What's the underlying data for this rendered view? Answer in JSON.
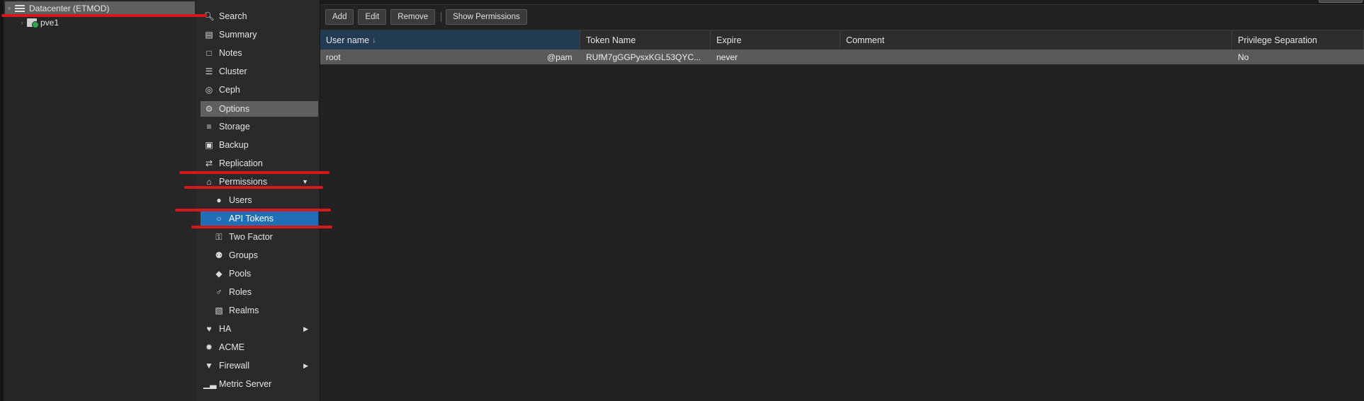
{
  "tree": {
    "datacenter": "Datacenter (ETMOD)",
    "node": "pve1"
  },
  "menu": {
    "items": [
      {
        "label": "Search",
        "icon": "search-icon"
      },
      {
        "label": "Summary",
        "icon": "book-icon"
      },
      {
        "label": "Notes",
        "icon": "notes-icon"
      },
      {
        "label": "Cluster",
        "icon": "server-icon"
      },
      {
        "label": "Ceph",
        "icon": "ceph-icon"
      },
      {
        "label": "Options",
        "icon": "gear-icon"
      },
      {
        "label": "Storage",
        "icon": "database-icon"
      },
      {
        "label": "Backup",
        "icon": "floppy-icon"
      },
      {
        "label": "Replication",
        "icon": "retweet-icon"
      },
      {
        "label": "Permissions",
        "icon": "unlock-icon"
      },
      {
        "label": "Users",
        "icon": "user-icon"
      },
      {
        "label": "API Tokens",
        "icon": "user-outline-icon"
      },
      {
        "label": "Two Factor",
        "icon": "key-icon"
      },
      {
        "label": "Groups",
        "icon": "users-icon"
      },
      {
        "label": "Pools",
        "icon": "tags-icon"
      },
      {
        "label": "Roles",
        "icon": "male-icon"
      },
      {
        "label": "Realms",
        "icon": "address-book-icon"
      },
      {
        "label": "HA",
        "icon": "heartbeat-icon"
      },
      {
        "label": "ACME",
        "icon": "certificate-icon"
      },
      {
        "label": "Firewall",
        "icon": "shield-icon"
      },
      {
        "label": "Metric Server",
        "icon": "bar-chart-icon"
      }
    ]
  },
  "toolbar": {
    "add": "Add",
    "edit": "Edit",
    "remove": "Remove",
    "show_permissions": "Show Permissions"
  },
  "grid": {
    "columns": [
      "User name",
      "Token Name",
      "Expire",
      "Comment",
      "Privilege Separation"
    ],
    "sort_indicator": "↓",
    "rows": [
      {
        "user": "root",
        "realm": "@pam",
        "token": "RUfM7gGGPysxKGL53QYC...",
        "expire": "never",
        "comment": "",
        "privsep": "No"
      }
    ]
  },
  "colors": {
    "selected": "#1f6fb6",
    "annotation": "#d6171c"
  }
}
